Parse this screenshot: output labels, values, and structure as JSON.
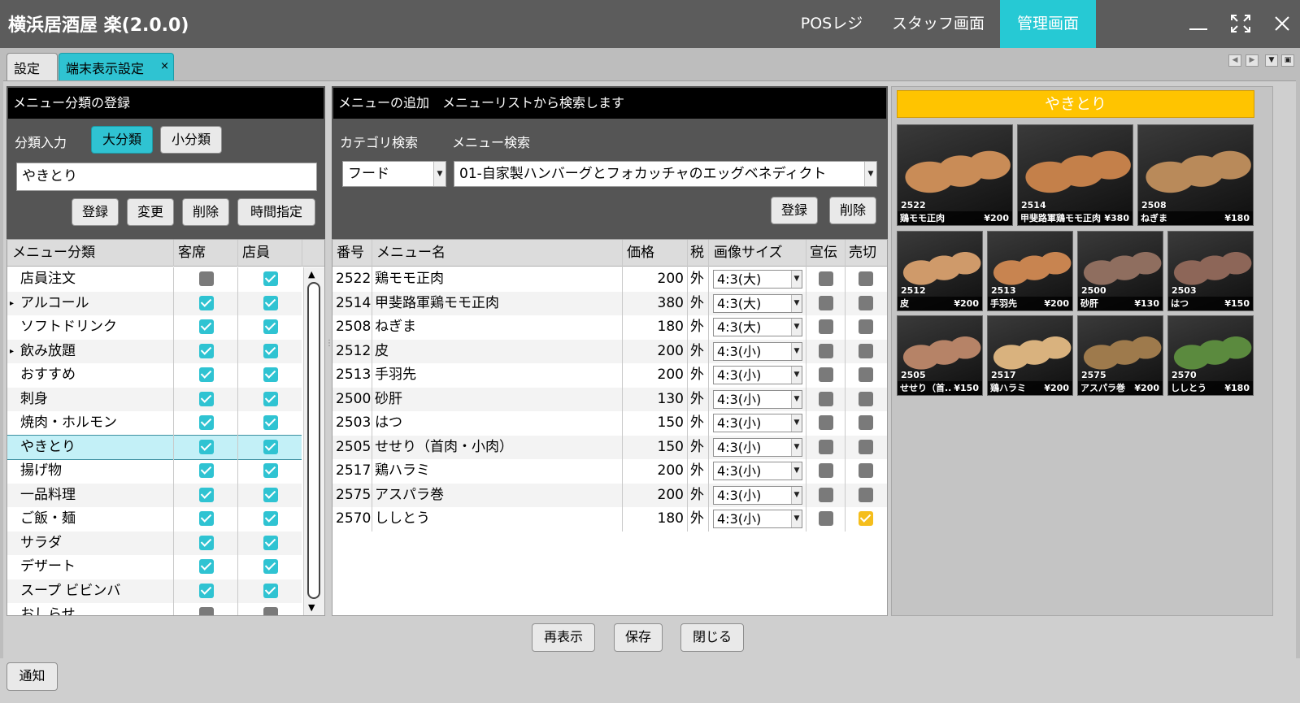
{
  "titlebar": {
    "app_title": "横浜居酒屋 楽(2.0.0)",
    "nav": [
      "POSレジ",
      "スタッフ画面",
      "管理画面"
    ],
    "active_nav": "管理画面"
  },
  "tabs": [
    {
      "label": "設定",
      "active": false
    },
    {
      "label": "端末表示設定",
      "active": true,
      "close": "×"
    }
  ],
  "category_panel": {
    "header": "メニュー分類の登録",
    "input_label": "分類入力",
    "toggle": [
      "大分類",
      "小分類"
    ],
    "input_value": "やきとり",
    "buttons": [
      "登録",
      "変更",
      "削除",
      "時間指定"
    ],
    "columns": [
      "メニュー分類",
      "客席",
      "店員"
    ],
    "rows": [
      {
        "name": "店員注文",
        "expand": false,
        "guest": false,
        "staff": true
      },
      {
        "name": "アルコール",
        "expand": true,
        "guest": true,
        "staff": true
      },
      {
        "name": "ソフトドリンク",
        "expand": false,
        "guest": true,
        "staff": true
      },
      {
        "name": "飲み放題",
        "expand": true,
        "guest": true,
        "staff": true
      },
      {
        "name": "おすすめ",
        "expand": false,
        "guest": true,
        "staff": true
      },
      {
        "name": "刺身",
        "expand": false,
        "guest": true,
        "staff": true
      },
      {
        "name": "焼肉・ホルモン",
        "expand": false,
        "guest": true,
        "staff": true
      },
      {
        "name": "やきとり",
        "expand": false,
        "guest": true,
        "staff": true,
        "selected": true
      },
      {
        "name": "揚げ物",
        "expand": false,
        "guest": true,
        "staff": true
      },
      {
        "name": "一品料理",
        "expand": false,
        "guest": true,
        "staff": true
      },
      {
        "name": "ご飯・麺",
        "expand": false,
        "guest": true,
        "staff": true
      },
      {
        "name": "サラダ",
        "expand": false,
        "guest": true,
        "staff": true
      },
      {
        "name": "デザート",
        "expand": false,
        "guest": true,
        "staff": true
      },
      {
        "name": "スープ ビビンバ",
        "expand": false,
        "guest": true,
        "staff": true
      },
      {
        "name": "おしらせ",
        "expand": false,
        "guest": false,
        "staff": false
      }
    ]
  },
  "menu_panel": {
    "header": "メニューの追加　メニューリストから検索します",
    "category_search_label": "カテゴリ検索",
    "menu_search_label": "メニュー検索",
    "category_value": "フード",
    "menu_value": "01-自家製ハンバーグとフォカッチャのエッグベネディクト",
    "buttons": [
      "登録",
      "削除"
    ],
    "columns": [
      "番号",
      "メニュー名",
      "価格",
      "税",
      "画像サイズ",
      "宣伝",
      "売切"
    ],
    "rows": [
      {
        "no": "2522",
        "name": "鶏モモ正肉",
        "price": "200",
        "tax": "外",
        "size": "4:3(大)",
        "promo": false,
        "soldout": false
      },
      {
        "no": "2514",
        "name": "甲斐路軍鶏モモ正肉",
        "price": "380",
        "tax": "外",
        "size": "4:3(大)",
        "promo": false,
        "soldout": false
      },
      {
        "no": "2508",
        "name": "ねぎま",
        "price": "180",
        "tax": "外",
        "size": "4:3(大)",
        "promo": false,
        "soldout": false
      },
      {
        "no": "2512",
        "name": "皮",
        "price": "200",
        "tax": "外",
        "size": "4:3(小)",
        "promo": false,
        "soldout": false
      },
      {
        "no": "2513",
        "name": "手羽先",
        "price": "200",
        "tax": "外",
        "size": "4:3(小)",
        "promo": false,
        "soldout": false
      },
      {
        "no": "2500",
        "name": "砂肝",
        "price": "130",
        "tax": "外",
        "size": "4:3(小)",
        "promo": false,
        "soldout": false
      },
      {
        "no": "2503",
        "name": "はつ",
        "price": "150",
        "tax": "外",
        "size": "4:3(小)",
        "promo": false,
        "soldout": false
      },
      {
        "no": "2505",
        "name": "せせり（首肉・小肉）",
        "price": "150",
        "tax": "外",
        "size": "4:3(小)",
        "promo": false,
        "soldout": false
      },
      {
        "no": "2517",
        "name": "鶏ハラミ",
        "price": "200",
        "tax": "外",
        "size": "4:3(小)",
        "promo": false,
        "soldout": false
      },
      {
        "no": "2575",
        "name": "アスパラ巻",
        "price": "200",
        "tax": "外",
        "size": "4:3(小)",
        "promo": false,
        "soldout": false
      },
      {
        "no": "2570",
        "name": "ししとう",
        "price": "180",
        "tax": "外",
        "size": "4:3(小)",
        "promo": false,
        "soldout": true
      }
    ]
  },
  "preview": {
    "category_title": "やきとり",
    "tiles": [
      {
        "no": "2522",
        "name": "鶏モモ正肉",
        "price": "¥200",
        "tone": "#c98c57"
      },
      {
        "no": "2514",
        "name": "甲斐路軍鶏モモ正肉",
        "price": "¥380",
        "tone": "#c4804a"
      },
      {
        "no": "2508",
        "name": "ねぎま",
        "price": "¥180",
        "tone": "#b98a5a"
      },
      {
        "no": "2512",
        "name": "皮",
        "price": "¥200",
        "tone": "#cf9a6a"
      },
      {
        "no": "2513",
        "name": "手羽先",
        "price": "¥200",
        "tone": "#c88450"
      },
      {
        "no": "2500",
        "name": "砂肝",
        "price": "¥130",
        "tone": "#8f6e5f"
      },
      {
        "no": "2503",
        "name": "はつ",
        "price": "¥150",
        "tone": "#8d6658"
      },
      {
        "no": "2505",
        "name": "せせり（首...",
        "price": "¥150",
        "tone": "#b68367"
      },
      {
        "no": "2517",
        "name": "鶏ハラミ",
        "price": "¥200",
        "tone": "#d9b27e"
      },
      {
        "no": "2575",
        "name": "アスパラ巻",
        "price": "¥200",
        "tone": "#9e7a4c"
      },
      {
        "no": "2570",
        "name": "ししとう",
        "price": "¥180",
        "tone": "#5b8a3e"
      }
    ]
  },
  "bottom_buttons": [
    "再表示",
    "保存",
    "閉じる"
  ],
  "footer_button": "通知"
}
